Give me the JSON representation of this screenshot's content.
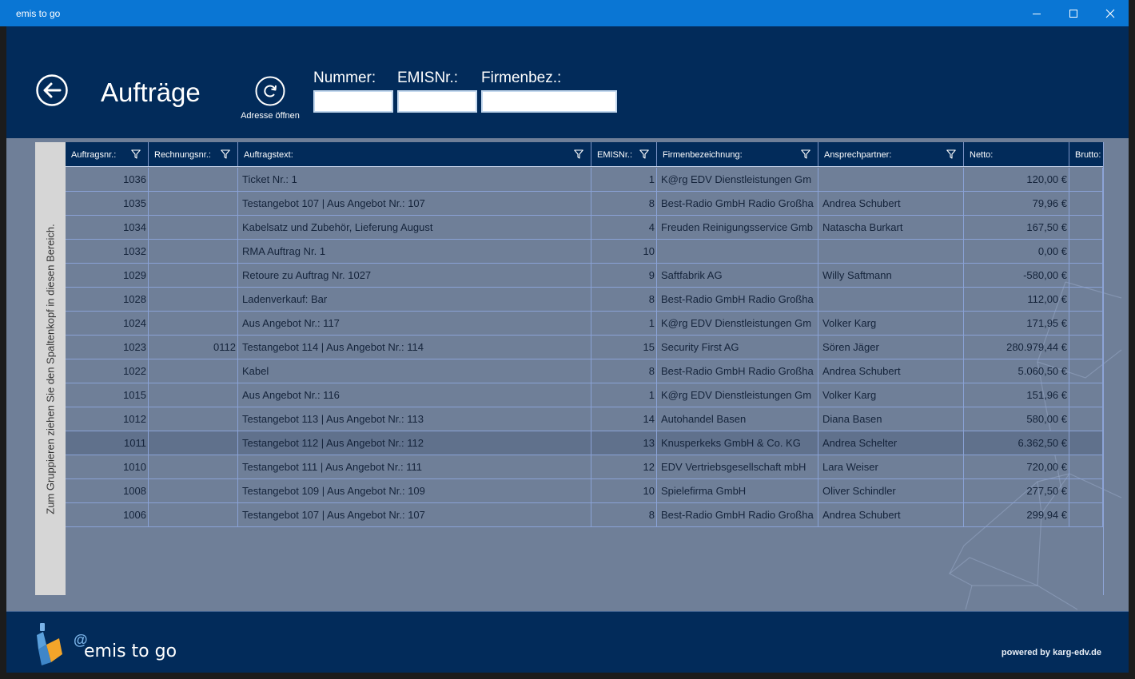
{
  "window": {
    "title": "emis to go"
  },
  "header": {
    "page_title": "Aufträge",
    "refresh_label": "Adresse öffnen",
    "filters": [
      {
        "label": "Nummer:",
        "value": ""
      },
      {
        "label": "EMISNr.:",
        "value": ""
      },
      {
        "label": "Firmenbez.:",
        "value": ""
      }
    ]
  },
  "grid": {
    "group_hint": "Zum Gruppieren ziehen Sie den Spaltenkopf in diesen Bereich.",
    "columns": [
      "Auftragsnr.:",
      "Rechnungsnr.:",
      "Auftragstext:",
      "EMISNr.:",
      "Firmenbezeichnung:",
      "Ansprechpartner:",
      "Netto:",
      "Brutto:"
    ],
    "rows": [
      {
        "auftragsnr": "1036",
        "rechnungsnr": "",
        "auftragstext": "Ticket Nr.: 1",
        "emisnr": "1",
        "firma": "K@rg EDV Dienstleistungen Gm",
        "ansprechpartner": "",
        "netto": "120,00 €"
      },
      {
        "auftragsnr": "1035",
        "rechnungsnr": "",
        "auftragstext": "Testangebot 107 | Aus Angebot Nr.: 107",
        "emisnr": "8",
        "firma": "Best-Radio GmbH Radio Großha",
        "ansprechpartner": "Andrea Schubert",
        "netto": "79,96 €"
      },
      {
        "auftragsnr": "1034",
        "rechnungsnr": "",
        "auftragstext": "Kabelsatz und Zubehör, Lieferung August",
        "emisnr": "4",
        "firma": "Freuden Reinigungsservice Gmb",
        "ansprechpartner": "Natascha Burkart",
        "netto": "167,50 €"
      },
      {
        "auftragsnr": "1032",
        "rechnungsnr": "",
        "auftragstext": "RMA Auftrag Nr. 1",
        "emisnr": "10",
        "firma": "",
        "ansprechpartner": "",
        "netto": "0,00 €"
      },
      {
        "auftragsnr": "1029",
        "rechnungsnr": "",
        "auftragstext": "Retoure zu Auftrag Nr. 1027",
        "emisnr": "9",
        "firma": "Saftfabrik AG",
        "ansprechpartner": "Willy Saftmann",
        "netto": "-580,00 €"
      },
      {
        "auftragsnr": "1028",
        "rechnungsnr": "",
        "auftragstext": "Ladenverkauf: Bar",
        "emisnr": "8",
        "firma": "Best-Radio GmbH Radio Großha",
        "ansprechpartner": "",
        "netto": "112,00 €"
      },
      {
        "auftragsnr": "1024",
        "rechnungsnr": "",
        "auftragstext": "Aus Angebot Nr.: 117",
        "emisnr": "1",
        "firma": "K@rg EDV Dienstleistungen Gm",
        "ansprechpartner": "Volker Karg",
        "netto": "171,95 €"
      },
      {
        "auftragsnr": "1023",
        "rechnungsnr": "0112",
        "auftragstext": "Testangebot 114 | Aus Angebot Nr.: 114",
        "emisnr": "15",
        "firma": "Security First AG",
        "ansprechpartner": "Sören Jäger",
        "netto": "280.979,44 €"
      },
      {
        "auftragsnr": "1022",
        "rechnungsnr": "",
        "auftragstext": "Kabel",
        "emisnr": "8",
        "firma": "Best-Radio GmbH Radio Großha",
        "ansprechpartner": "Andrea Schubert",
        "netto": "5.060,50 €"
      },
      {
        "auftragsnr": "1015",
        "rechnungsnr": "",
        "auftragstext": "Aus Angebot Nr.: 116",
        "emisnr": "1",
        "firma": "K@rg EDV Dienstleistungen Gm",
        "ansprechpartner": "Volker Karg",
        "netto": "151,96 €"
      },
      {
        "auftragsnr": "1012",
        "rechnungsnr": "",
        "auftragstext": "Testangebot 113 | Aus Angebot Nr.: 113",
        "emisnr": "14",
        "firma": "Autohandel Basen",
        "ansprechpartner": "Diana Basen",
        "netto": "580,00 €"
      },
      {
        "auftragsnr": "1011",
        "rechnungsnr": "",
        "auftragstext": "Testangebot 112 | Aus Angebot Nr.: 112",
        "emisnr": "13",
        "firma": "Knusperkeks GmbH & Co. KG",
        "ansprechpartner": "Andrea Schelter",
        "netto": "6.362,50 €",
        "selected": true
      },
      {
        "auftragsnr": "1010",
        "rechnungsnr": "",
        "auftragstext": "Testangebot 111 | Aus Angebot Nr.: 111",
        "emisnr": "12",
        "firma": "EDV Vertriebsgesellschaft mbH",
        "ansprechpartner": "Lara Weiser",
        "netto": "720,00 €"
      },
      {
        "auftragsnr": "1008",
        "rechnungsnr": "",
        "auftragstext": "Testangebot 109 | Aus Angebot Nr.: 109",
        "emisnr": "10",
        "firma": "Spielefirma GmbH",
        "ansprechpartner": "Oliver Schindler",
        "netto": "277,50 €"
      },
      {
        "auftragsnr": "1006",
        "rechnungsnr": "",
        "auftragstext": "Testangebot 107 | Aus Angebot Nr.: 107",
        "emisnr": "8",
        "firma": "Best-Radio GmbH Radio Großha",
        "ansprechpartner": "Andrea Schubert",
        "netto": "299,94 €"
      }
    ]
  },
  "footer": {
    "brand": "emis to go",
    "logo_glyph": "@",
    "powered_by": "powered by karg-edv.de"
  },
  "icons": {
    "back": "back-arrow-icon",
    "refresh": "refresh-icon",
    "filter": "filter-funnel-icon",
    "minimize": "minimize-icon",
    "maximize": "maximize-icon",
    "close": "close-icon"
  }
}
